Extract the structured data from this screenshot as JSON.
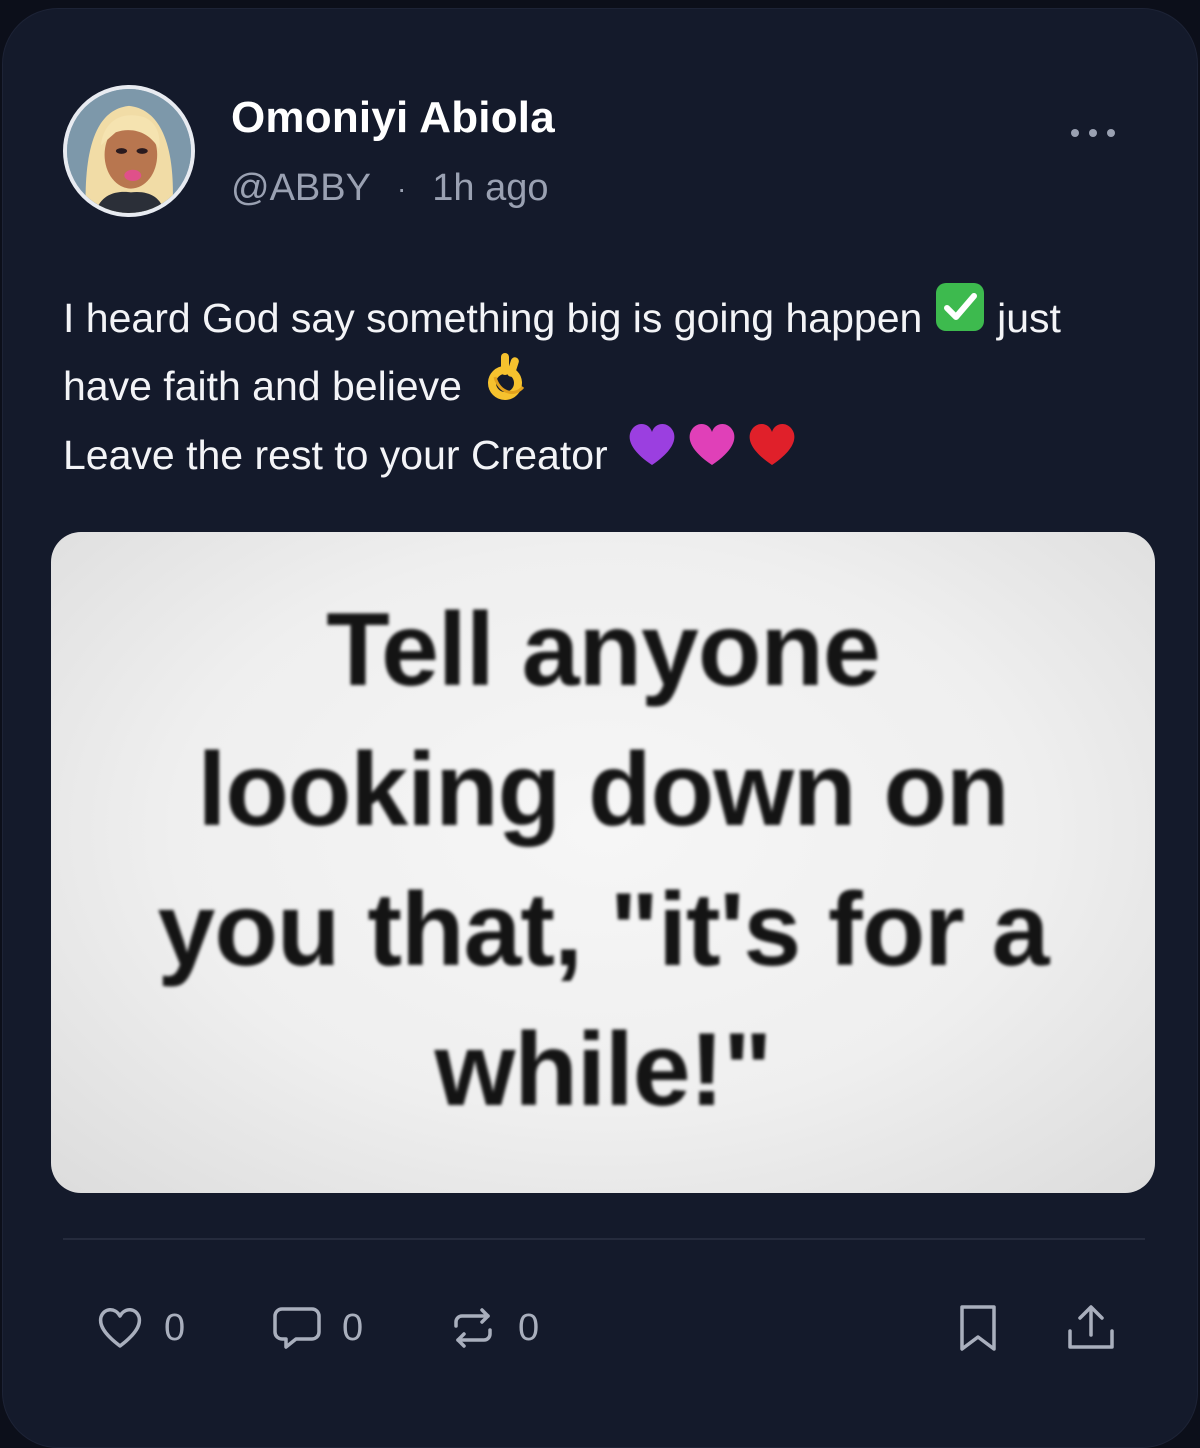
{
  "post": {
    "author": {
      "display_name": "Omoniyi Abiola",
      "handle": "@ABBY",
      "separator": "·",
      "time": "1h ago"
    },
    "body": {
      "line1": "I heard God say something big is going happen",
      "line1_emoji": "check-mark-button-emoji",
      "line1_end": " just",
      "line2": "have faith and believe",
      "line2_emoji": "ok-hand-emoji",
      "line3": "Leave the rest to your Creator",
      "line3_emojis": [
        "purple-heart-emoji",
        "pink-heart-emoji",
        "red-heart-emoji"
      ]
    },
    "image": {
      "text": "Tell anyone\nlooking down on\nyou that, \"it's for a\nwhile!\""
    },
    "actions": {
      "like_count": "0",
      "reply_count": "0",
      "repost_count": "0"
    }
  },
  "icons": {
    "more": "more-icon",
    "like": "heart-icon",
    "reply": "comment-icon",
    "repost": "repost-icon",
    "bookmark": "bookmark-icon",
    "share": "share-icon"
  },
  "colors": {
    "background": "#0c0f1a",
    "card": "#141a2b",
    "primary_text": "#f3f4f7",
    "secondary_text": "#9aa1b2",
    "check_green": "#3dba4e",
    "purple_heart": "#9b3fe0",
    "pink_heart": "#e040b8",
    "red_heart": "#e0202a"
  }
}
